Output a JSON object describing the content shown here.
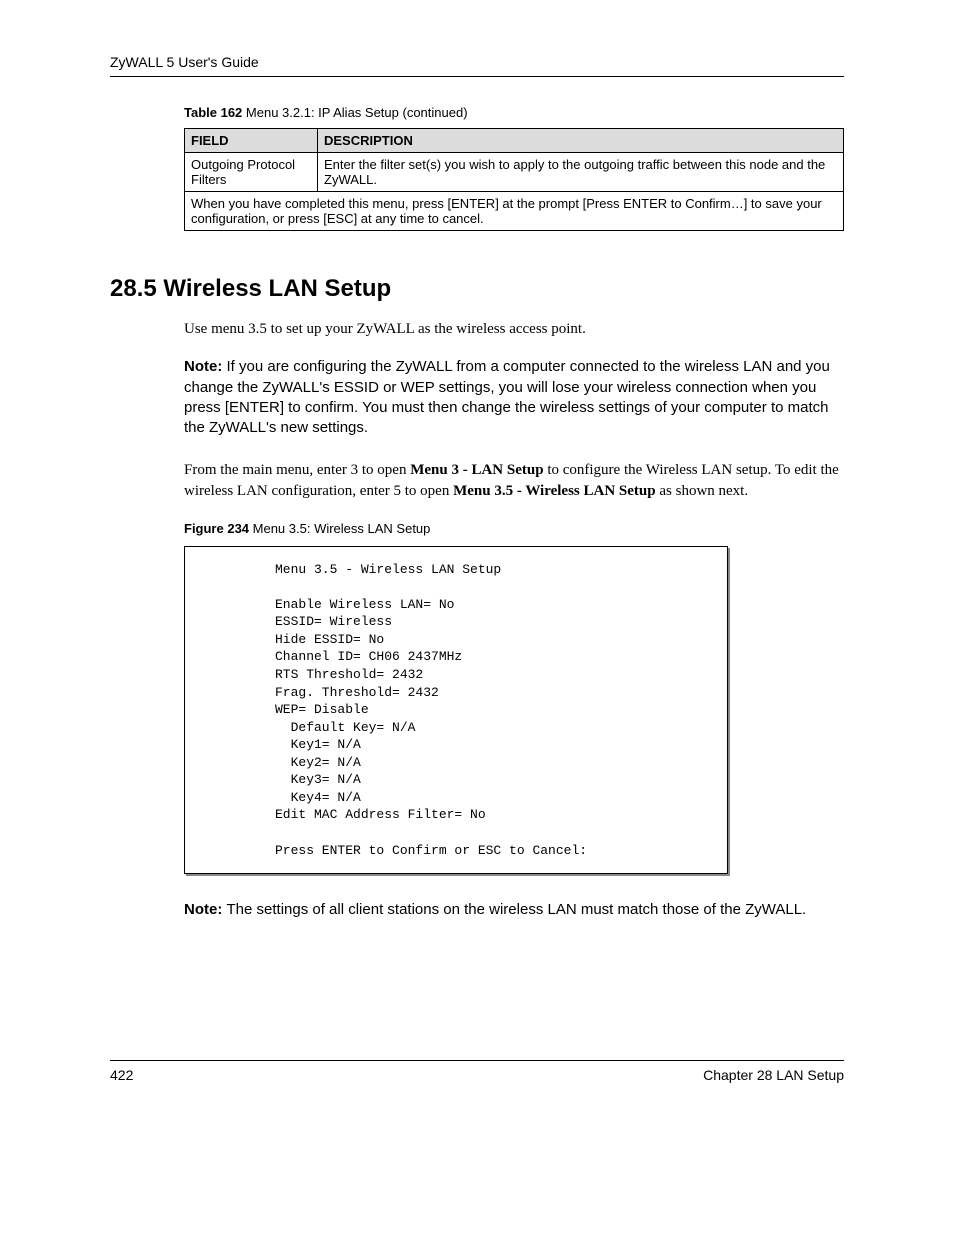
{
  "header": "ZyWALL 5 User's Guide",
  "table": {
    "caption_bold": "Table 162",
    "caption_rest": "   Menu 3.2.1: IP Alias Setup (continued)",
    "head_field": "FIELD",
    "head_desc": "DESCRIPTION",
    "row_field": "Outgoing Protocol Filters",
    "row_desc": "Enter the filter set(s) you wish to apply to the outgoing traffic between this node and the ZyWALL.",
    "footer_row": "When you have completed this menu, press [ENTER] at the prompt [Press ENTER to Confirm…] to save your configuration, or press [ESC] at any time to cancel."
  },
  "section_title": "28.5  Wireless LAN Setup",
  "intro": "Use menu 3.5 to set up your ZyWALL as the wireless access point.",
  "note1": {
    "label": "Note: ",
    "text": "If you are configuring the ZyWALL from a computer connected to the wireless LAN and you change the ZyWALL's ESSID or WEP settings, you will lose your wireless connection when you press [ENTER] to confirm. You must then change the wireless settings of your computer to match the ZyWALL's new settings."
  },
  "from_main": {
    "p1a": "From the main menu, enter 3 to open ",
    "p1b": "Menu 3 - LAN Setup",
    "p1c": " to configure the Wireless LAN setup. To edit the wireless LAN configuration, enter 5 to open ",
    "p1d": "Menu 3.5 - Wireless LAN Setup",
    "p1e": " as shown next."
  },
  "figure": {
    "caption_bold": "Figure 234",
    "caption_rest": "   Menu 3.5: Wireless LAN Setup"
  },
  "terminal": "Menu 3.5 - Wireless LAN Setup\n\nEnable Wireless LAN= No\nESSID= Wireless\nHide ESSID= No\nChannel ID= CH06 2437MHz\nRTS Threshold= 2432\nFrag. Threshold= 2432\nWEP= Disable\n  Default Key= N/A\n  Key1= N/A\n  Key2= N/A\n  Key3= N/A\n  Key4= N/A\nEdit MAC Address Filter= No\n\nPress ENTER to Confirm or ESC to Cancel:",
  "note2": {
    "label": "Note: ",
    "text": "The settings of all client stations on the wireless LAN must match those of the ZyWALL."
  },
  "footer": {
    "page": "422",
    "chapter": "Chapter 28 LAN Setup"
  }
}
